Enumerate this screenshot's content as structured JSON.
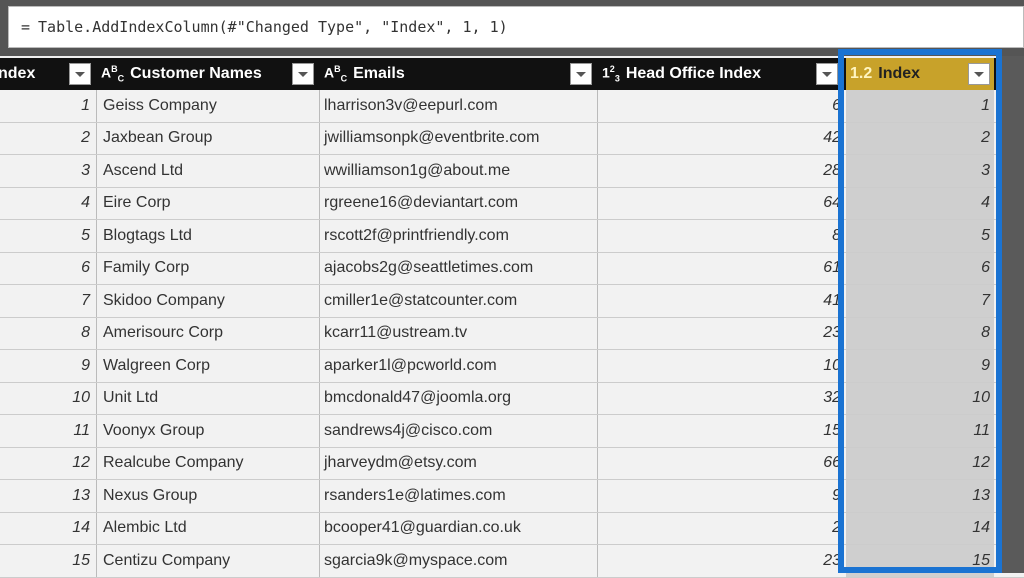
{
  "formula_bar": {
    "prefix": "=",
    "expression": "Table.AddIndexColumn(#\"Changed Type\", \"Index\", 1, 1)"
  },
  "columns": [
    {
      "name": "Index",
      "type_icon": "",
      "display": "ndex"
    },
    {
      "name": "Customer Names",
      "type_icon": "ABC"
    },
    {
      "name": "Emails",
      "type_icon": "ABC"
    },
    {
      "name": "Head Office Index",
      "type_icon": "123"
    },
    {
      "name": "Index",
      "type_icon": "1.2",
      "selected": true
    }
  ],
  "colors": {
    "header_bg": "#111111",
    "selected_header_bg": "#c8a22a",
    "selection_border": "#1a73d2",
    "selected_cell_bg": "#cfcfcf"
  },
  "rows": [
    {
      "index": "1",
      "name": "Geiss Company",
      "email": "lharrison3v@eepurl.com",
      "head_office": "6",
      "new_index": "1"
    },
    {
      "index": "2",
      "name": "Jaxbean Group",
      "email": "jwilliamsonpk@eventbrite.com",
      "head_office": "42",
      "new_index": "2"
    },
    {
      "index": "3",
      "name": "Ascend Ltd",
      "email": "wwilliamson1g@about.me",
      "head_office": "28",
      "new_index": "3"
    },
    {
      "index": "4",
      "name": "Eire Corp",
      "email": "rgreene16@deviantart.com",
      "head_office": "64",
      "new_index": "4"
    },
    {
      "index": "5",
      "name": "Blogtags Ltd",
      "email": "rscott2f@printfriendly.com",
      "head_office": "8",
      "new_index": "5"
    },
    {
      "index": "6",
      "name": "Family Corp",
      "email": "ajacobs2g@seattletimes.com",
      "head_office": "61",
      "new_index": "6"
    },
    {
      "index": "7",
      "name": "Skidoo Company",
      "email": "cmiller1e@statcounter.com",
      "head_office": "41",
      "new_index": "7"
    },
    {
      "index": "8",
      "name": "Amerisourc Corp",
      "email": "kcarr11@ustream.tv",
      "head_office": "23",
      "new_index": "8"
    },
    {
      "index": "9",
      "name": "Walgreen Corp",
      "email": "aparker1l@pcworld.com",
      "head_office": "10",
      "new_index": "9"
    },
    {
      "index": "10",
      "name": "Unit Ltd",
      "email": "bmcdonald47@joomla.org",
      "head_office": "32",
      "new_index": "10"
    },
    {
      "index": "11",
      "name": "Voonyx Group",
      "email": "sandrews4j@cisco.com",
      "head_office": "15",
      "new_index": "11"
    },
    {
      "index": "12",
      "name": "Realcube Company",
      "email": "jharveydm@etsy.com",
      "head_office": "66",
      "new_index": "12"
    },
    {
      "index": "13",
      "name": "Nexus Group",
      "email": "rsanders1e@latimes.com",
      "head_office": "9",
      "new_index": "13"
    },
    {
      "index": "14",
      "name": "Alembic Ltd",
      "email": "bcooper41@guardian.co.uk",
      "head_office": "2",
      "new_index": "14"
    },
    {
      "index": "15",
      "name": "Centizu Company",
      "email": "sgarcia9k@myspace.com",
      "head_office": "23",
      "new_index": "15"
    }
  ]
}
